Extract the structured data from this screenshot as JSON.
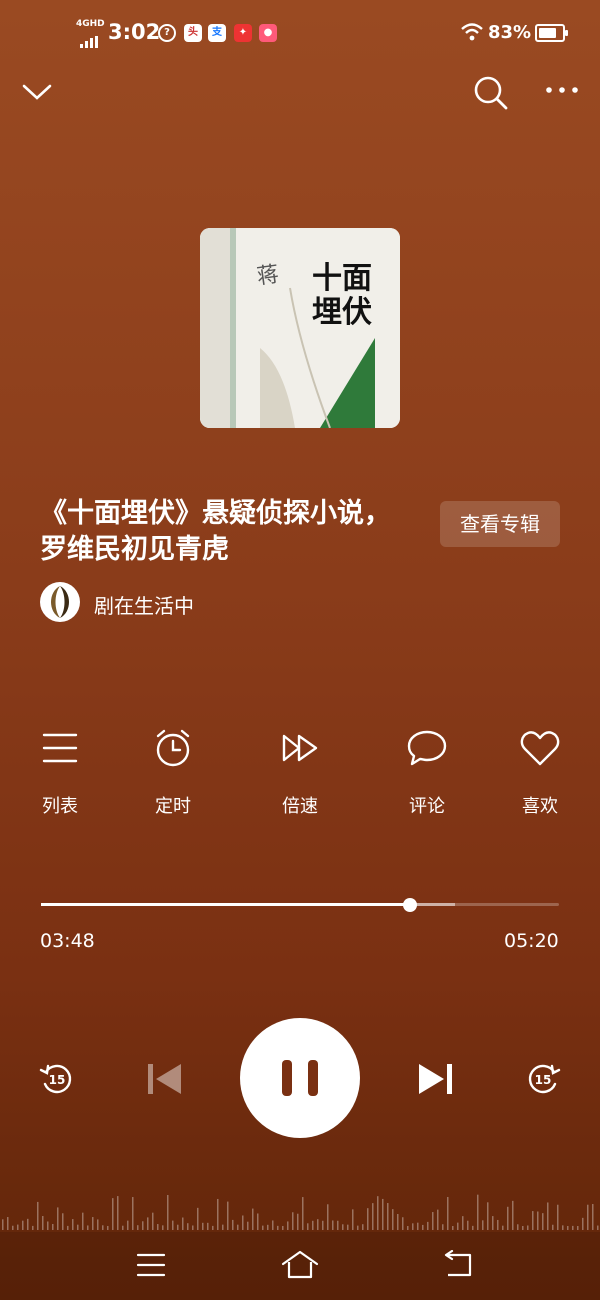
{
  "status_bar": {
    "network": "4GHD",
    "time": "3:02",
    "battery": "83%",
    "battery_level": 0.83,
    "app_icons": [
      "toutiao-icon",
      "alipay-icon",
      "app-icon-red",
      "app-icon-pink"
    ]
  },
  "header": {
    "icons": [
      "chevron-down-icon",
      "search-icon",
      "more-icon"
    ]
  },
  "cover": {
    "lines": [
      "十面",
      "埋伏"
    ],
    "vertical_text": "蒋子丹"
  },
  "track": {
    "title": "《十面埋伏》悬疑侦探小说，罗维民初见青虎",
    "view_album_label": "查看专辑",
    "author": "剧在生活中"
  },
  "actions": [
    {
      "label": "列表",
      "icon": "list-icon"
    },
    {
      "label": "定时",
      "icon": "alarm-clock-icon"
    },
    {
      "label": "倍速",
      "icon": "speed-icon"
    },
    {
      "label": "评论",
      "icon": "comment-icon"
    },
    {
      "label": "喜欢",
      "icon": "heart-icon"
    }
  ],
  "progress": {
    "current": "03:48",
    "total": "05:20",
    "played_fraction": 0.7125,
    "buffered_fraction": 0.8
  },
  "controls": {
    "rewind_seconds": "15",
    "forward_seconds": "15",
    "state": "playing"
  },
  "nav": [
    "menu-icon",
    "home-icon",
    "back-icon"
  ]
}
